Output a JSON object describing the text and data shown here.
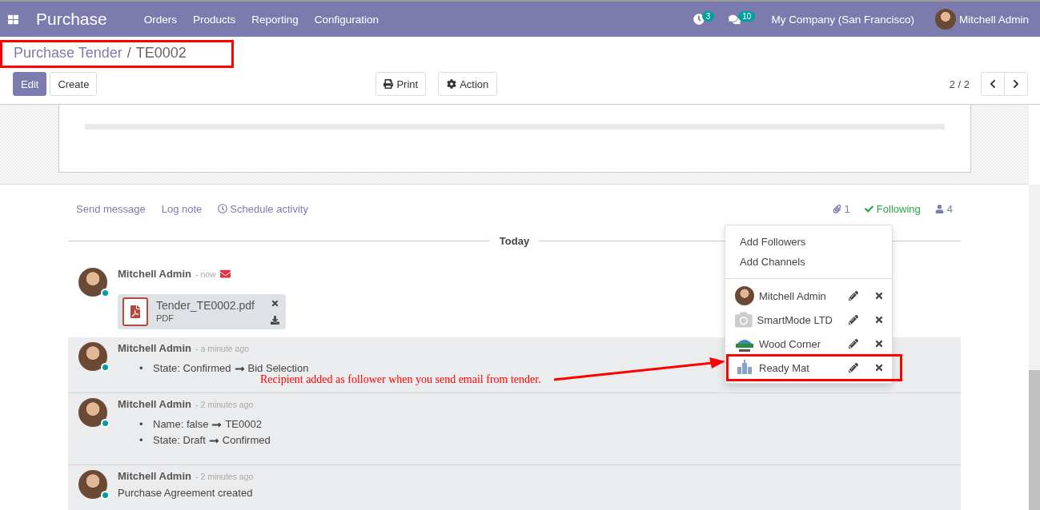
{
  "navbar": {
    "app_name": "Purchase",
    "menu": [
      "Orders",
      "Products",
      "Reporting",
      "Configuration"
    ],
    "activity_count": "3",
    "message_count": "10",
    "company": "My Company (San Francisco)",
    "user": "Mitchell Admin"
  },
  "breadcrumb": {
    "parent": "Purchase Tender",
    "separator": "/",
    "current": "TE0002",
    "highlighted": true
  },
  "buttons": {
    "edit": "Edit",
    "create": "Create",
    "print": "Print",
    "action": "Action"
  },
  "pager": "2 / 2",
  "chatter": {
    "tabs": [
      "Send message",
      "Log note",
      "Schedule activity"
    ],
    "attachment_count": "1",
    "following": "Following",
    "follower_count": "4",
    "separator": "Today",
    "messages": [
      {
        "kind": "attachment",
        "author": "Mitchell Admin",
        "time": "- now",
        "via_email": true,
        "file_name": "Tender_TE0002.pdf",
        "file_type": "PDF"
      },
      {
        "kind": "tracking",
        "author": "Mitchell Admin",
        "time": "- a minute ago",
        "via_email": false,
        "changes": [
          {
            "bullet": "•",
            "field": "State:",
            "old": "Confirmed",
            "new": "Bid Selection"
          }
        ]
      },
      {
        "kind": "tracking",
        "author": "Mitchell Admin",
        "time": "- 2 minutes ago",
        "via_email": false,
        "changes": [
          {
            "bullet": "•",
            "field": "Name:",
            "old": "false",
            "new": "TE0002"
          },
          {
            "bullet": "•",
            "field": "State:",
            "old": "Draft",
            "new": "Confirmed"
          }
        ]
      },
      {
        "kind": "text",
        "author": "Mitchell Admin",
        "time": "- 2 minutes ago",
        "via_email": false,
        "body": "Purchase Agreement created"
      }
    ],
    "followers_menu": {
      "actions": [
        "Add Followers",
        "Add Channels"
      ],
      "followers": [
        {
          "name": "Mitchell Admin",
          "kind": "photo",
          "highlighted": false
        },
        {
          "name": "SmartMode LTD",
          "kind": "placeholder",
          "highlighted": false
        },
        {
          "name": "Wood Corner",
          "kind": "logo",
          "highlighted": false
        },
        {
          "name": "Ready Mat",
          "kind": "building",
          "highlighted": true
        }
      ]
    }
  },
  "annotation": "Recipient added as follower when you send email from tender."
}
